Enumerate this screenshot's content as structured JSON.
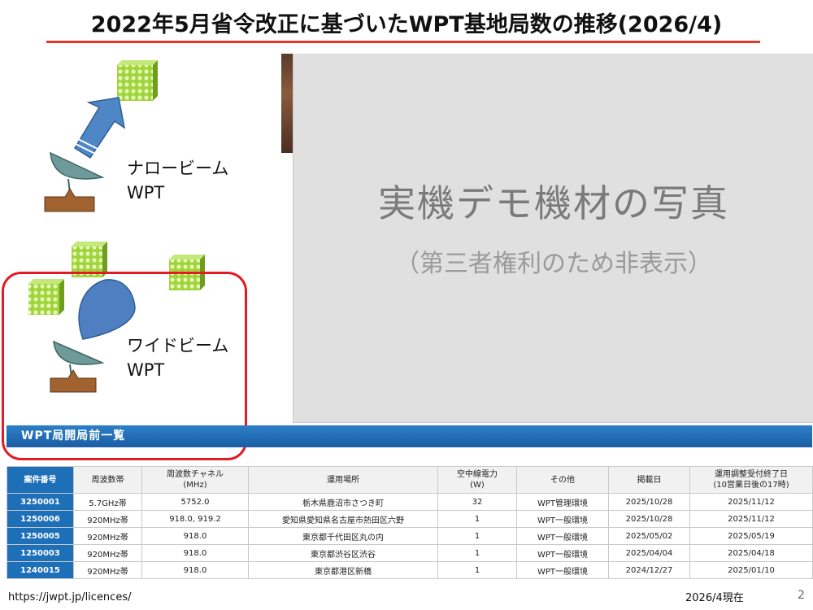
{
  "slide": {
    "title": "2022年5月省令改正に基づいたWPT基地局数の推移(2026/4)",
    "page_number": "2"
  },
  "diagram": {
    "narrow_label_line1": "ナロービーム",
    "narrow_label_line2": "WPT",
    "wide_label_line1": "ワイドビーム",
    "wide_label_line2": "WPT",
    "colors": {
      "receiver": "#9fd43a",
      "arrow": "#4f86c6",
      "dish": "#6f9a9a",
      "stand": "#a0622f",
      "highlight_border": "#e21b24"
    }
  },
  "photo": {
    "title": "実機デモ機材の写真",
    "subtitle": "（第三者権利のため非表示）"
  },
  "licence_list": {
    "heading": "WPT局開局前一覧",
    "columns": [
      "案件番号",
      "周波数帯",
      "周波数チャネル\n(MHz)",
      "運用場所",
      "空中線電力\n(W)",
      "その他",
      "掲載日",
      "運用調整受付終了日\n(10営業日後の17時)"
    ],
    "rows": [
      [
        "3250001",
        "5.7GHz帯",
        "5752.0",
        "栃木県鹿沼市さつき町",
        "32",
        "WPT管理環境",
        "2025/10/28",
        "2025/11/12"
      ],
      [
        "1250006",
        "920MHz帯",
        "918.0, 919.2",
        "愛知県愛知県名古屋市熱田区六野",
        "1",
        "WPT一般環境",
        "2025/10/28",
        "2025/11/12"
      ],
      [
        "1250005",
        "920MHz帯",
        "918.0",
        "東京都千代田区丸の内",
        "1",
        "WPT一般環境",
        "2025/05/02",
        "2025/05/19"
      ],
      [
        "1250003",
        "920MHz帯",
        "918.0",
        "東京都渋谷区渋谷",
        "1",
        "WPT一般環境",
        "2025/04/04",
        "2025/04/18"
      ],
      [
        "1240015",
        "920MHz帯",
        "918.0",
        "東京都港区新橋",
        "1",
        "WPT一般環境",
        "2024/12/27",
        "2025/01/10"
      ]
    ]
  },
  "footer": {
    "url": "https://jwpt.jp/licences/",
    "as_of": "2026/4現在"
  }
}
